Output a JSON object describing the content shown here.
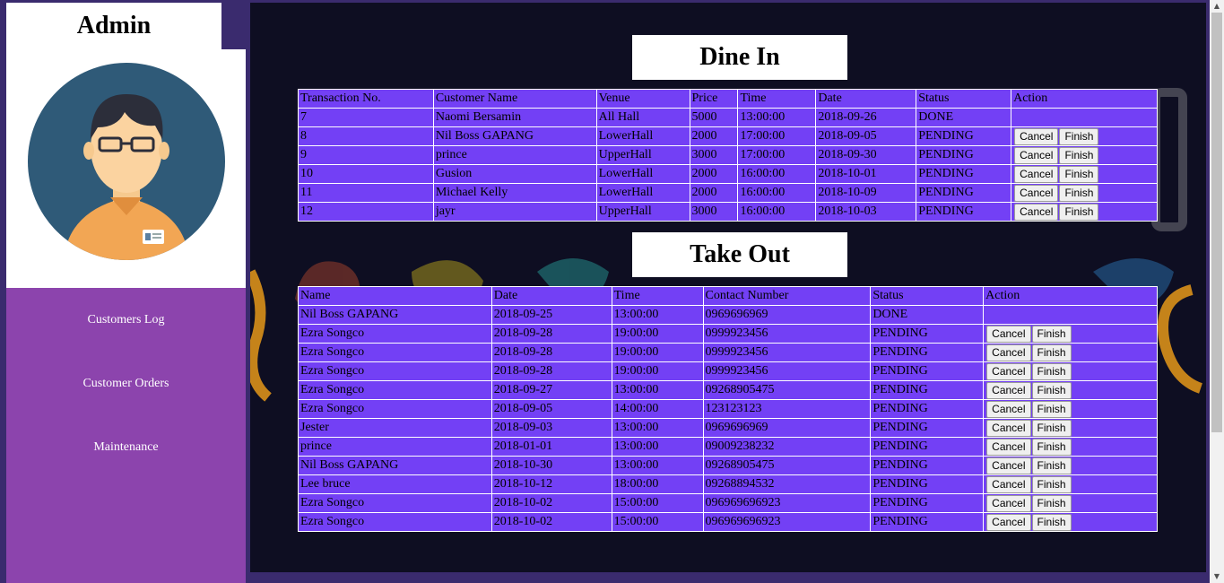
{
  "sidebar": {
    "title": "Admin",
    "menu": [
      {
        "label": "Customers Log"
      },
      {
        "label": "Customer Orders"
      },
      {
        "label": "Maintenance"
      }
    ]
  },
  "dine_in": {
    "title": "Dine In",
    "headers": [
      "Transaction No.",
      "Customer Name",
      "Venue",
      "Price",
      "Time",
      "Date",
      "Status",
      "Action"
    ],
    "rows": [
      {
        "no": "7",
        "name": "Naomi Bersamin",
        "venue": "All Hall",
        "price": "5000",
        "time": "13:00:00",
        "date": "2018-09-26",
        "status": "DONE",
        "actions": false
      },
      {
        "no": "8",
        "name": "Nil Boss GAPANG",
        "venue": "LowerHall",
        "price": "2000",
        "time": "17:00:00",
        "date": "2018-09-05",
        "status": "PENDING",
        "actions": true
      },
      {
        "no": "9",
        "name": "prince",
        "venue": "UpperHall",
        "price": "3000",
        "time": "17:00:00",
        "date": "2018-09-30",
        "status": "PENDING",
        "actions": true
      },
      {
        "no": "10",
        "name": "Gusion",
        "venue": "LowerHall",
        "price": "2000",
        "time": "16:00:00",
        "date": "2018-10-01",
        "status": "PENDING",
        "actions": true
      },
      {
        "no": "11",
        "name": "Michael Kelly",
        "venue": "LowerHall",
        "price": "2000",
        "time": "16:00:00",
        "date": "2018-10-09",
        "status": "PENDING",
        "actions": true
      },
      {
        "no": "12",
        "name": "jayr",
        "venue": "UpperHall",
        "price": "3000",
        "time": "16:00:00",
        "date": "2018-10-03",
        "status": "PENDING",
        "actions": true
      }
    ]
  },
  "take_out": {
    "title": "Take Out",
    "headers": [
      "Name",
      "Date",
      "Time",
      "Contact Number",
      "Status",
      "Action"
    ],
    "rows": [
      {
        "name": "Nil Boss GAPANG",
        "date": "2018-09-25",
        "time": "13:00:00",
        "contact": "0969696969",
        "status": "DONE",
        "actions": false
      },
      {
        "name": "Ezra Songco",
        "date": "2018-09-28",
        "time": "19:00:00",
        "contact": "0999923456",
        "status": "PENDING",
        "actions": true
      },
      {
        "name": "Ezra Songco",
        "date": "2018-09-28",
        "time": "19:00:00",
        "contact": "0999923456",
        "status": "PENDING",
        "actions": true
      },
      {
        "name": "Ezra Songco",
        "date": "2018-09-28",
        "time": "19:00:00",
        "contact": "0999923456",
        "status": "PENDING",
        "actions": true
      },
      {
        "name": "Ezra Songco",
        "date": "2018-09-27",
        "time": "13:00:00",
        "contact": "09268905475",
        "status": "PENDING",
        "actions": true
      },
      {
        "name": "Ezra Songco",
        "date": "2018-09-05",
        "time": "14:00:00",
        "contact": "123123123",
        "status": "PENDING",
        "actions": true
      },
      {
        "name": "Jester",
        "date": "2018-09-03",
        "time": "13:00:00",
        "contact": "0969696969",
        "status": "PENDING",
        "actions": true
      },
      {
        "name": "prince",
        "date": "2018-01-01",
        "time": "13:00:00",
        "contact": "09009238232",
        "status": "PENDING",
        "actions": true
      },
      {
        "name": "Nil Boss GAPANG",
        "date": "2018-10-30",
        "time": "13:00:00",
        "contact": "09268905475",
        "status": "PENDING",
        "actions": true
      },
      {
        "name": "Lee bruce",
        "date": "2018-10-12",
        "time": "18:00:00",
        "contact": "09268894532",
        "status": "PENDING",
        "actions": true
      },
      {
        "name": "Ezra Songco",
        "date": "2018-10-02",
        "time": "15:00:00",
        "contact": "096969696923",
        "status": "PENDING",
        "actions": true
      },
      {
        "name": "Ezra Songco",
        "date": "2018-10-02",
        "time": "15:00:00",
        "contact": "096969696923",
        "status": "PENDING",
        "actions": true
      }
    ]
  },
  "buttons": {
    "cancel": "Cancel",
    "finish": "Finish"
  },
  "colors": {
    "page_bg": "#3a2b6e",
    "main_bg": "#0e0e22",
    "table_bg": "#7340f5",
    "menu_bg": "#8c44ad",
    "avatar_circle": "#2f5a78"
  }
}
